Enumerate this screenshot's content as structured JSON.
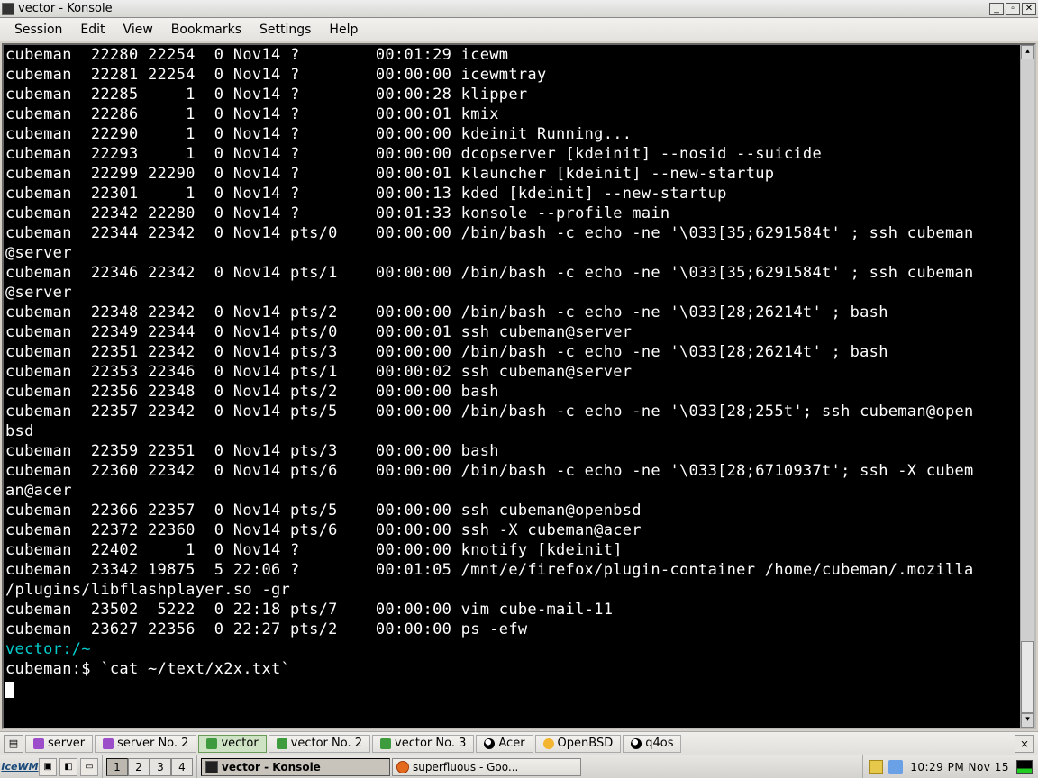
{
  "window": {
    "title": "vector - Konsole"
  },
  "menu": {
    "session": "Session",
    "edit": "Edit",
    "view": "View",
    "bookmarks": "Bookmarks",
    "settings": "Settings",
    "help": "Help"
  },
  "terminal": {
    "lines": [
      "cubeman  22280 22254  0 Nov14 ?        00:01:29 icewm",
      "cubeman  22281 22254  0 Nov14 ?        00:00:00 icewmtray",
      "cubeman  22285     1  0 Nov14 ?        00:00:28 klipper",
      "cubeman  22286     1  0 Nov14 ?        00:00:01 kmix",
      "cubeman  22290     1  0 Nov14 ?        00:00:00 kdeinit Running...",
      "cubeman  22293     1  0 Nov14 ?        00:00:00 dcopserver [kdeinit] --nosid --suicide",
      "cubeman  22299 22290  0 Nov14 ?        00:00:01 klauncher [kdeinit] --new-startup",
      "cubeman  22301     1  0 Nov14 ?        00:00:13 kded [kdeinit] --new-startup",
      "cubeman  22342 22280  0 Nov14 ?        00:01:33 konsole --profile main",
      "cubeman  22344 22342  0 Nov14 pts/0    00:00:00 /bin/bash -c echo -ne '\\033[35;6291584t' ; ssh cubeman",
      "@server",
      "cubeman  22346 22342  0 Nov14 pts/1    00:00:00 /bin/bash -c echo -ne '\\033[35;6291584t' ; ssh cubeman",
      "@server",
      "cubeman  22348 22342  0 Nov14 pts/2    00:00:00 /bin/bash -c echo -ne '\\033[28;26214t' ; bash",
      "cubeman  22349 22344  0 Nov14 pts/0    00:00:01 ssh cubeman@server",
      "cubeman  22351 22342  0 Nov14 pts/3    00:00:00 /bin/bash -c echo -ne '\\033[28;26214t' ; bash",
      "cubeman  22353 22346  0 Nov14 pts/1    00:00:02 ssh cubeman@server",
      "cubeman  22356 22348  0 Nov14 pts/2    00:00:00 bash",
      "cubeman  22357 22342  0 Nov14 pts/5    00:00:00 /bin/bash -c echo -ne '\\033[28;255t'; ssh cubeman@open",
      "bsd",
      "cubeman  22359 22351  0 Nov14 pts/3    00:00:00 bash",
      "cubeman  22360 22342  0 Nov14 pts/6    00:00:00 /bin/bash -c echo -ne '\\033[28;6710937t'; ssh -X cubem",
      "an@acer",
      "cubeman  22366 22357  0 Nov14 pts/5    00:00:00 ssh cubeman@openbsd",
      "cubeman  22372 22360  0 Nov14 pts/6    00:00:00 ssh -X cubeman@acer",
      "cubeman  22402     1  0 Nov14 ?        00:00:00 knotify [kdeinit]",
      "cubeman  23342 19875  5 22:06 ?        00:01:05 /mnt/e/firefox/plugin-container /home/cubeman/.mozilla",
      "/plugins/libflashplayer.so -gr",
      "cubeman  23502  5222  0 22:18 pts/7    00:00:00 vim cube-mail-11",
      "cubeman  23627 22356  0 22:27 pts/2    00:00:00 ps -efw"
    ],
    "prompt_host": "vector:/~",
    "prompt_user": "cubeman:$ ",
    "prompt_cmd": "`cat ~/text/x2x.txt`"
  },
  "sessiontabs": {
    "items": [
      {
        "label": "server",
        "iconClass": "icon-term-purple",
        "active": false
      },
      {
        "label": "server No. 2",
        "iconClass": "icon-term-purple",
        "active": false
      },
      {
        "label": "vector",
        "iconClass": "icon-term-green",
        "active": true
      },
      {
        "label": "vector No. 2",
        "iconClass": "icon-term-green",
        "active": false
      },
      {
        "label": "vector No. 3",
        "iconClass": "icon-term-green",
        "active": false
      },
      {
        "label": "Acer",
        "iconClass": "icon-tux",
        "active": false
      },
      {
        "label": "OpenBSD",
        "iconClass": "icon-openbsd",
        "active": false
      },
      {
        "label": "q4os",
        "iconClass": "icon-tux",
        "active": false
      }
    ]
  },
  "taskbar": {
    "logo": "IceWM",
    "workspaces": [
      "1",
      "2",
      "3",
      "4"
    ],
    "activeWorkspace": 0,
    "tasks": [
      {
        "label": "vector - Konsole",
        "iconClass": "ticon-konsole",
        "active": true
      },
      {
        "label": "superfluous - Goo...",
        "iconClass": "ticon-firefox",
        "active": false
      }
    ],
    "clock": "10:29 PM Nov 15"
  }
}
